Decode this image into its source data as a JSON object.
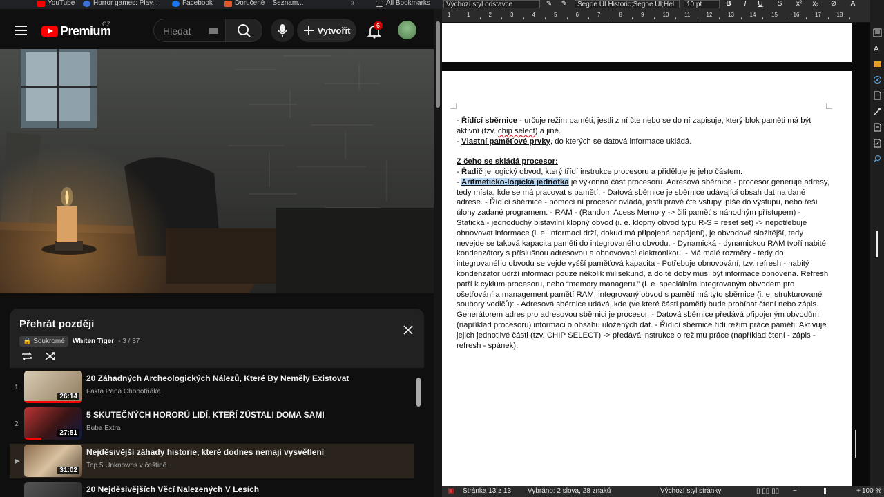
{
  "bookmarks": [
    {
      "label": "YouTube",
      "color": "#ff0000"
    },
    {
      "label": "Horror games: Play...",
      "color": "#3b6fd6"
    },
    {
      "label": "Facebook",
      "color": "#1877f2"
    },
    {
      "label": "Doručené – Seznam...",
      "color": "#e2552a"
    }
  ],
  "bookmarks_overflow": "»",
  "all_bookmarks": "All Bookmarks",
  "youtube": {
    "logo": "Premium",
    "country": "CZ",
    "search_placeholder": "Hledat",
    "create_label": "Vytvořit",
    "notif_count": "6"
  },
  "playlist": {
    "title": "Přehrát později",
    "privacy": "Soukromé",
    "owner": "Whiten Tiger",
    "position": "- 3 / 37",
    "items": [
      {
        "index": "1",
        "title": "20 Záhadných Archeologických Nálezů, Které By Neměly Existovat",
        "channel": "Fakta Pana Chobotňáka",
        "duration": "26:14",
        "progress": 1.0
      },
      {
        "index": "2",
        "title": "5 SKUTEČNÝCH HORORŮ LIDÍ, KTEŘÍ ZŮSTALI DOMA SAMI",
        "channel": "Buba Extra",
        "duration": "27:51",
        "progress": 0.3
      },
      {
        "index": "▶",
        "title": "Nejděsivější záhady historie, které dodnes nemají vysvětlení",
        "channel": "Top 5 Unknowns v češtině",
        "duration": "31:02",
        "progress": 0.0
      },
      {
        "index": "",
        "title": "20 Nejděsivějších Věcí Nalezených V Lesích",
        "channel": "",
        "duration": "",
        "progress": 0.0
      }
    ]
  },
  "writer": {
    "paragraph_style": "Výchozí styl odstavce",
    "font": "Segoe UI Historic;Segoe UI;Hel",
    "size": "10 pt",
    "bold": "B",
    "italic": "I",
    "underline": "U",
    "ruler_labels": [
      "1",
      "1",
      "2",
      "3",
      "4",
      "5",
      "6",
      "7",
      "8",
      "9",
      "10",
      "11",
      "12",
      "13",
      "14",
      "15",
      "16",
      "17",
      "18"
    ],
    "status": {
      "page": "Stránka 13 z 13",
      "selection": "Vybráno: 2 slova, 28 znaků",
      "page_style": "Výchozí styl stránky",
      "zoom": "100 %"
    },
    "doc": {
      "line1_bold": "Řídící sběrnice",
      "line1_rest": " - určuje režim paměti, jestli z ní čte nebo se do ní zapisuje, který blok paměti má být aktivní (tzv. ",
      "line1_chip": "chip select",
      "line1_end": ") a jiné.",
      "line2_bold": "Vlastní paměťové prvky",
      "line2_rest": ", do kterých se datová informace ukládá.",
      "heading": "Z čeho se skládá procesor:",
      "p1_bold": "Řadič",
      "p1_rest": " je logický obvod, který třídí instrukce procesoru a přiděluje je jeho částem.",
      "p2_sel": "Aritmeticko-logická jednotka",
      "p2_rest": " je výkonná část procesoru. ",
      "p2_body": "Adresová sběrnice - procesor generuje adresy, tedy místa, kde se má pracovat s pamětí. - Datová sběrnice je sběrnice udávající obsah dat na dané adrese. - Řídící sběrnice - pomocí ní procesor ovládá, jestli právě čte vstupy, píše do výstupu, nebo řeší úlohy zadané programem. - RAM - (Random Acess Memory -> čili paměť s náhodným přístupem) - Statická - jednoduchý bistavilní klopný obvod (i. e. klopný obvod typu R-S = reset set) -> nepotřebuje obnovovat informace (i. e. informaci drží, dokud má připojené napájení), je obvodově složitější, tedy nevejde se taková kapacita paměti do integrovaného obvodu. - Dynamická - dynamickou RAM tvoří nabité kondenzátory s příslušnou adresovou a obnovovací elektronikou. - Má malé rozměry - tedy do integrovaného obvodu se vejde vyšší paměťová kapacita - Potřebuje obnovování, tzv. refresh - nabitý kondenzátor udrží informaci pouze několik milisekund, a do té doby musí být informace obnovena. Refresh patří k cyklum procesoru, nebo “memory manageru.” (i. e. speciálním integrovaným obvodem pro ošetřování a management pamětí RAM. integrovaný obvod s pamětí má tyto sběrnice (i. e. strukturované soubory vodičů): - Adresová sběrnice udává, kde (ve které části paměti) bude probíhat čtení nebo zápis. Generátorem adres pro adresovou sběrnici je procesor. - Datová sběrnice předává připojeným obvodům (například procesoru) informaci o obsahu uložených dat. - Řídící sběrnice řídí režim práce paměti. Aktivuje jejich jednotlivé části (tzv. CHIP SELECT) -> předává instrukce o režimu práce (například čtení - zápis - refresh - spánek)."
    }
  }
}
